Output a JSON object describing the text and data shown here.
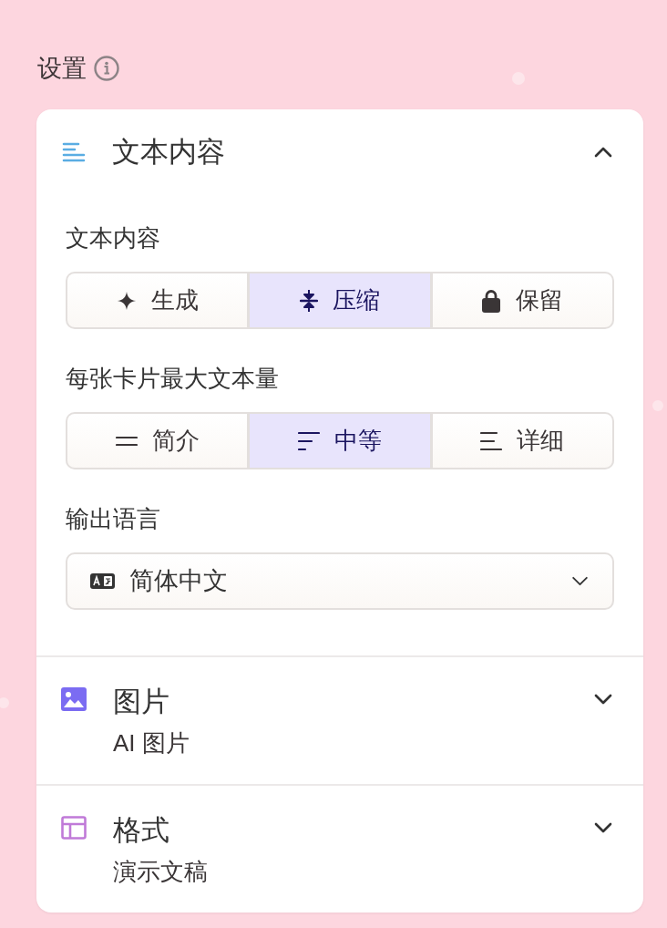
{
  "header": {
    "title": "设置"
  },
  "sections": [
    {
      "title": "文本内容",
      "color": "#5aade3",
      "expanded": true,
      "fields": [
        {
          "kind": "segmented",
          "label": "文本内容",
          "options": [
            {
              "label": "生成",
              "selected": false
            },
            {
              "label": "压缩",
              "selected": true
            },
            {
              "label": "保留",
              "selected": false
            }
          ]
        },
        {
          "kind": "segmented",
          "label": "每张卡片最大文本量",
          "options": [
            {
              "label": "简介",
              "selected": false
            },
            {
              "label": "中等",
              "selected": true
            },
            {
              "label": "详细",
              "selected": false
            }
          ]
        },
        {
          "kind": "select",
          "label": "输出语言",
          "value": "简体中文"
        }
      ]
    },
    {
      "title": "图片",
      "subtitle": "AI 图片",
      "color": "#7b6cf2",
      "expanded": false
    },
    {
      "title": "格式",
      "subtitle": "演示文稿",
      "color": "#c07ad8",
      "expanded": false
    }
  ]
}
